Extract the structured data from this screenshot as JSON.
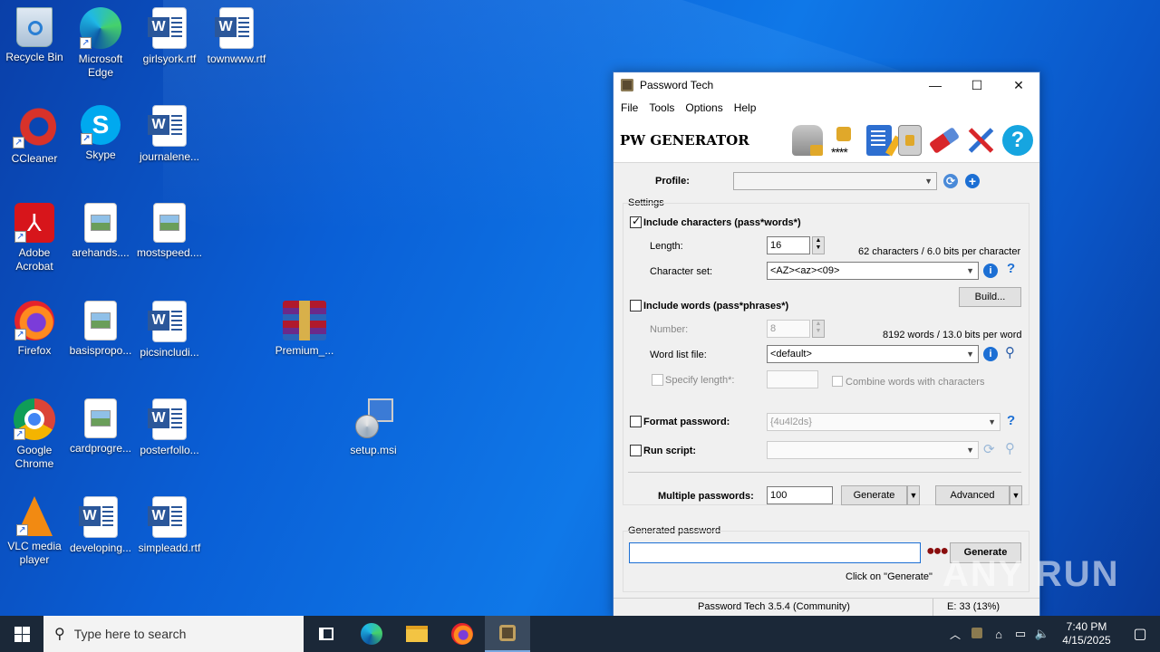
{
  "desktop": {
    "icons": [
      {
        "label": "Recycle Bin"
      },
      {
        "label": "Microsoft Edge"
      },
      {
        "label": "girlsyork.rtf"
      },
      {
        "label": "townwww.rtf"
      },
      {
        "label": "CCleaner"
      },
      {
        "label": "Skype"
      },
      {
        "label": "journalene..."
      },
      {
        "label": "Adobe Acrobat"
      },
      {
        "label": "arehands...."
      },
      {
        "label": "mostspeed...."
      },
      {
        "label": "Firefox"
      },
      {
        "label": "basispropo..."
      },
      {
        "label": "picsincludi..."
      },
      {
        "label": "Premium_..."
      },
      {
        "label": "Google Chrome"
      },
      {
        "label": "cardprogre..."
      },
      {
        "label": "posterfollo..."
      },
      {
        "label": "setup.msi"
      },
      {
        "label": "VLC media player"
      },
      {
        "label": "developing..."
      },
      {
        "label": "simpleadd.rtf"
      }
    ]
  },
  "window": {
    "title": "Password Tech",
    "menu": [
      "File",
      "Tools",
      "Options",
      "Help"
    ],
    "app_title": "PW GENERATOR",
    "profile_label": "Profile:",
    "settings_label": "Settings",
    "include_chars_label": "Include characters (pass*words*)",
    "length_label": "Length:",
    "length_value": "16",
    "chars_info": "62 characters / 6.0 bits per character",
    "charset_label": "Character set:",
    "charset_value": "<AZ><az><09>",
    "build_label": "Build...",
    "include_words_label": "Include words (pass*phrases*)",
    "number_label": "Number:",
    "number_value": "8",
    "words_info": "8192 words / 13.0 bits per word",
    "wordlist_label": "Word list file:",
    "wordlist_value": "<default>",
    "specify_length_label": "Specify length*:",
    "combine_label": "Combine words with characters",
    "format_label": "Format password:",
    "format_value": "{4u4l2ds}",
    "run_script_label": "Run script:",
    "multiple_label": "Multiple passwords:",
    "multiple_value": "100",
    "generate_label": "Generate",
    "advanced_label": "Advanced",
    "generated_group_label": "Generated password",
    "generated_value": "",
    "generate2_label": "Generate",
    "click_hint": "Click on \"Generate\"",
    "status_version": "Password Tech 3.5.4 (Community)",
    "status_entropy": "E: 33 (13%)"
  },
  "taskbar": {
    "search_placeholder": "Type here to search",
    "time": "7:40 PM",
    "date": "4/15/2025"
  },
  "watermark": "ANY RUN"
}
